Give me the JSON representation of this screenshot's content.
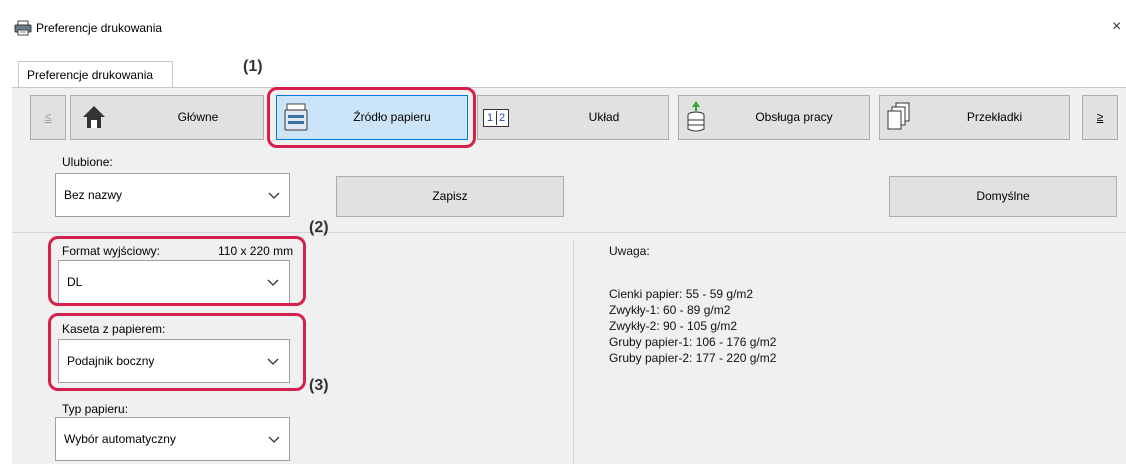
{
  "window": {
    "title": "Preferencje drukowania",
    "close_label": "×"
  },
  "tab": {
    "label": "Preferencje drukowania"
  },
  "callouts": {
    "c1": "(1)",
    "c2": "(2)",
    "c3": "(3)"
  },
  "nav": {
    "prev_label": "≤",
    "next_label": "≥",
    "main_label": "Główne",
    "paper_source_label": "Źródło papieru",
    "layout_label": "Układ",
    "job_handling_label": "Obsługa pracy",
    "inserts_label": "Przekładki",
    "layout_icon_text_1": "1",
    "layout_icon_text_2": "2"
  },
  "favorites": {
    "label": "Ulubione:",
    "value": "Bez nazwy",
    "save_label": "Zapisz",
    "defaults_label": "Domyślne"
  },
  "output_size": {
    "label": "Format wyjściowy:",
    "dimensions": "110 x 220 mm",
    "value": "DL"
  },
  "paper_tray": {
    "label": "Kaseta z papierem:",
    "value": "Podajnik boczny"
  },
  "paper_type": {
    "label": "Typ papieru:",
    "value": "Wybór automatyczny"
  },
  "note": {
    "title": "Uwaga:",
    "lines": [
      "Cienki papier: 55 - 59 g/m2",
      "Zwykły-1: 60 - 89 g/m2",
      "Zwykły-2: 90 - 105 g/m2",
      "Gruby papier-1: 106 - 176 g/m2",
      "Gruby papier-2: 177 - 220 g/m2"
    ]
  },
  "colors": {
    "highlight": "#d71f4b",
    "active_tab_bg": "#cce4f7",
    "active_border": "#0078d7"
  }
}
